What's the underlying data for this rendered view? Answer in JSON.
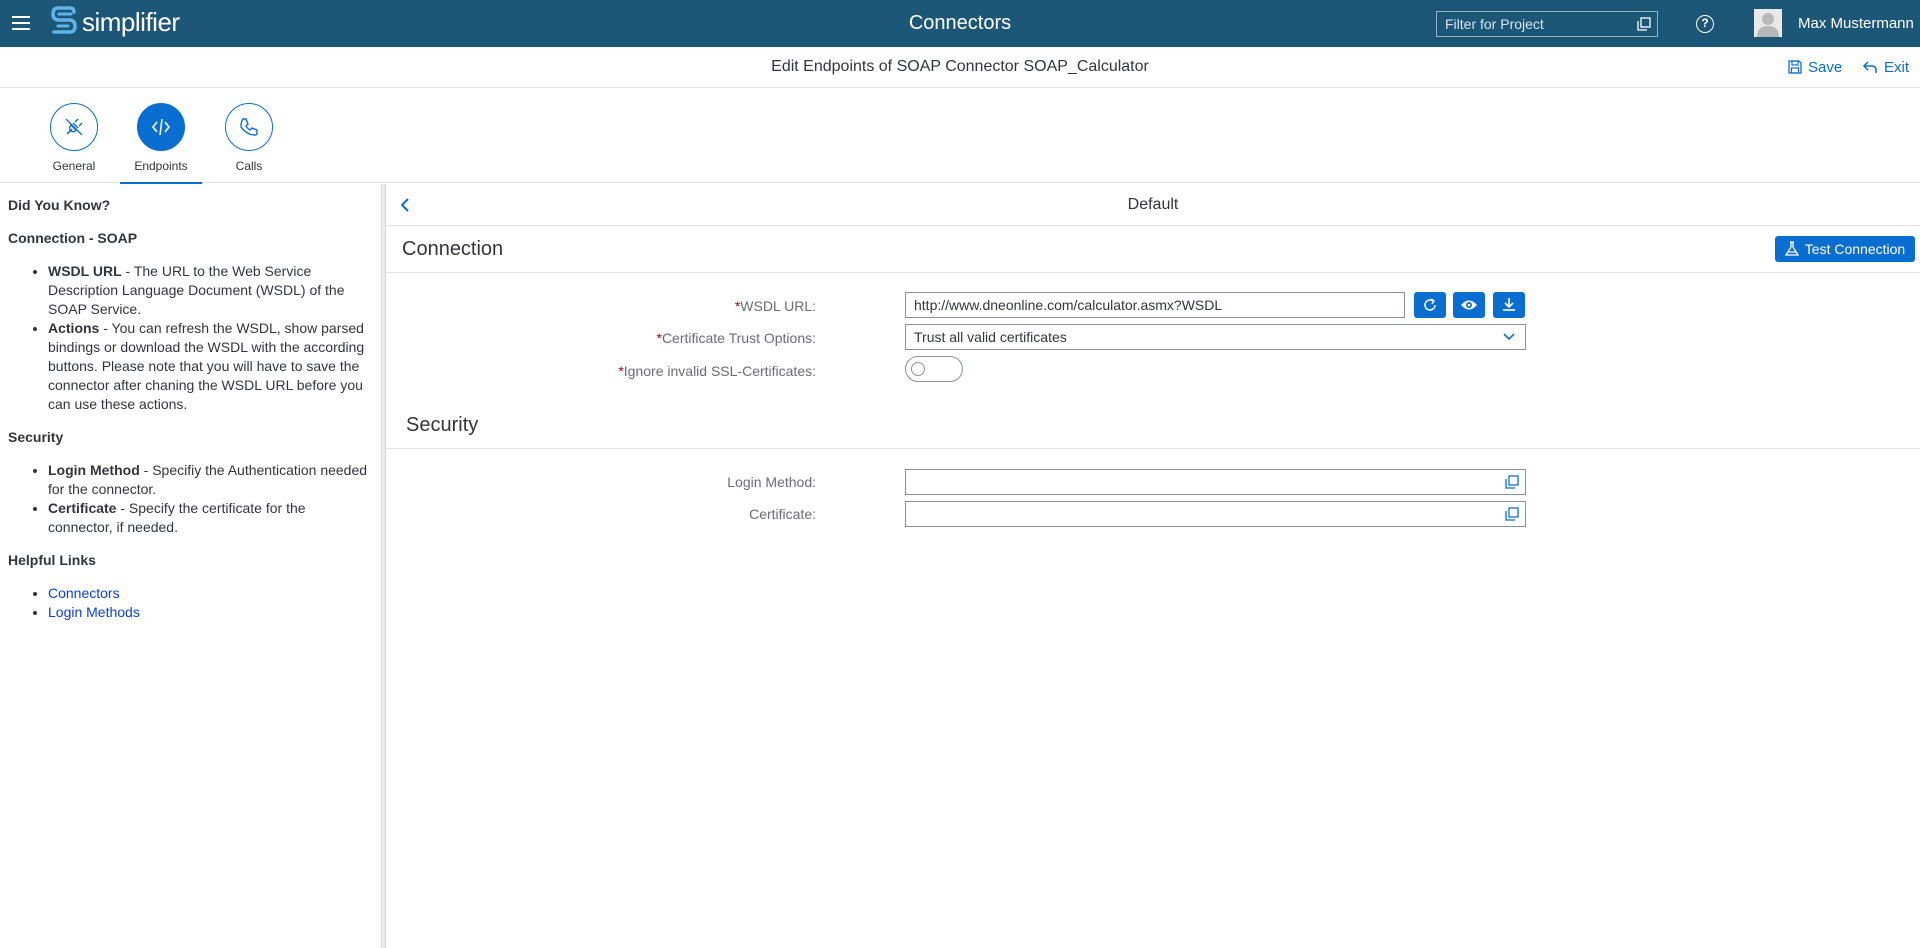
{
  "shell": {
    "logo_text": "simplifier",
    "title": "Connectors",
    "project_filter_placeholder": "Filter for Project",
    "help_glyph": "?",
    "user_name": "Max Mustermann"
  },
  "subheader": {
    "title": "Edit Endpoints of SOAP Connector SOAP_Calculator",
    "save_label": "Save",
    "exit_label": "Exit"
  },
  "tabs": [
    {
      "label": "General",
      "icon": "plug-icon"
    },
    {
      "label": "Endpoints",
      "icon": "endpoints-icon",
      "selected": true
    },
    {
      "label": "Calls",
      "icon": "phone-icon"
    }
  ],
  "help": {
    "heading": "Did You Know?",
    "connection_heading": "Connection - SOAP",
    "connection_items": [
      {
        "term": "WSDL URL",
        "text": " - The URL to the Web Service Description Language Document (WSDL) of the SOAP Service."
      },
      {
        "term": "Actions",
        "text": " - You can refresh the WSDL, show parsed bindings or download the WSDL with the according buttons. Please note that you will have to save the connector after chaning the WSDL URL before you can use these actions."
      }
    ],
    "security_heading": "Security",
    "security_items": [
      {
        "term": "Login Method",
        "text": " - Specifiy the Authentication needed for the connector."
      },
      {
        "term": "Certificate",
        "text": " - Specify the certificate for the connector, if needed."
      }
    ],
    "links_heading": "Helpful Links",
    "links": [
      "Connectors",
      "Login Methods"
    ]
  },
  "detail": {
    "nav_title": "Default",
    "connection_title": "Connection",
    "test_connection_label": "Test Connection",
    "required_marker": "*",
    "wsdl_label": "WSDL URL:",
    "wsdl_value": "http://www.dneonline.com/calculator.asmx?WSDL",
    "cert_trust_label": "Certificate Trust Options:",
    "cert_trust_value": "Trust all valid certificates",
    "ignore_ssl_label": "Ignore invalid SSL-Certificates:",
    "ignore_ssl_on": false,
    "security_title": "Security",
    "login_method_label": "Login Method:",
    "login_method_value": "",
    "certificate_label": "Certificate:",
    "certificate_value": ""
  },
  "colors": {
    "shell": "#1d5778",
    "accent": "#0a6ed1",
    "required": "#bb0000"
  }
}
